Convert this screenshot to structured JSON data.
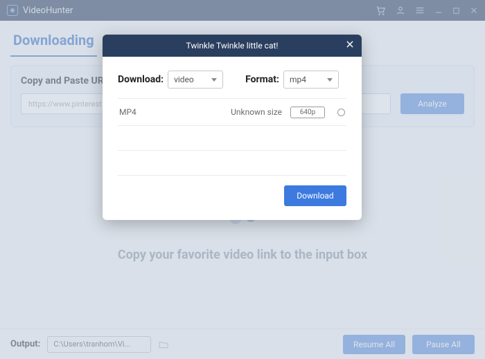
{
  "titlebar": {
    "app_name": "VideoHunter"
  },
  "tabs": {
    "downloading": "Downloading"
  },
  "paste": {
    "heading": "Copy and Paste URL",
    "url_placeholder": "https://www.pinterest",
    "analyze": "Analyze"
  },
  "hero": {
    "text": "Copy your favorite video link to the input box"
  },
  "footer": {
    "output_label": "Output:",
    "output_path": "C:\\Users\\tranhom\\Vi...",
    "resume_all": "Resume All",
    "pause_all": "Pause All"
  },
  "modal": {
    "title": "Twinkle Twinkle little cat!",
    "download_label": "Download:",
    "download_value": "video",
    "format_label": "Format:",
    "format_value": "mp4",
    "options": [
      {
        "format": "MP4",
        "size": "Unknown size",
        "quality": "640p",
        "selected": false
      }
    ],
    "download_btn": "Download"
  }
}
